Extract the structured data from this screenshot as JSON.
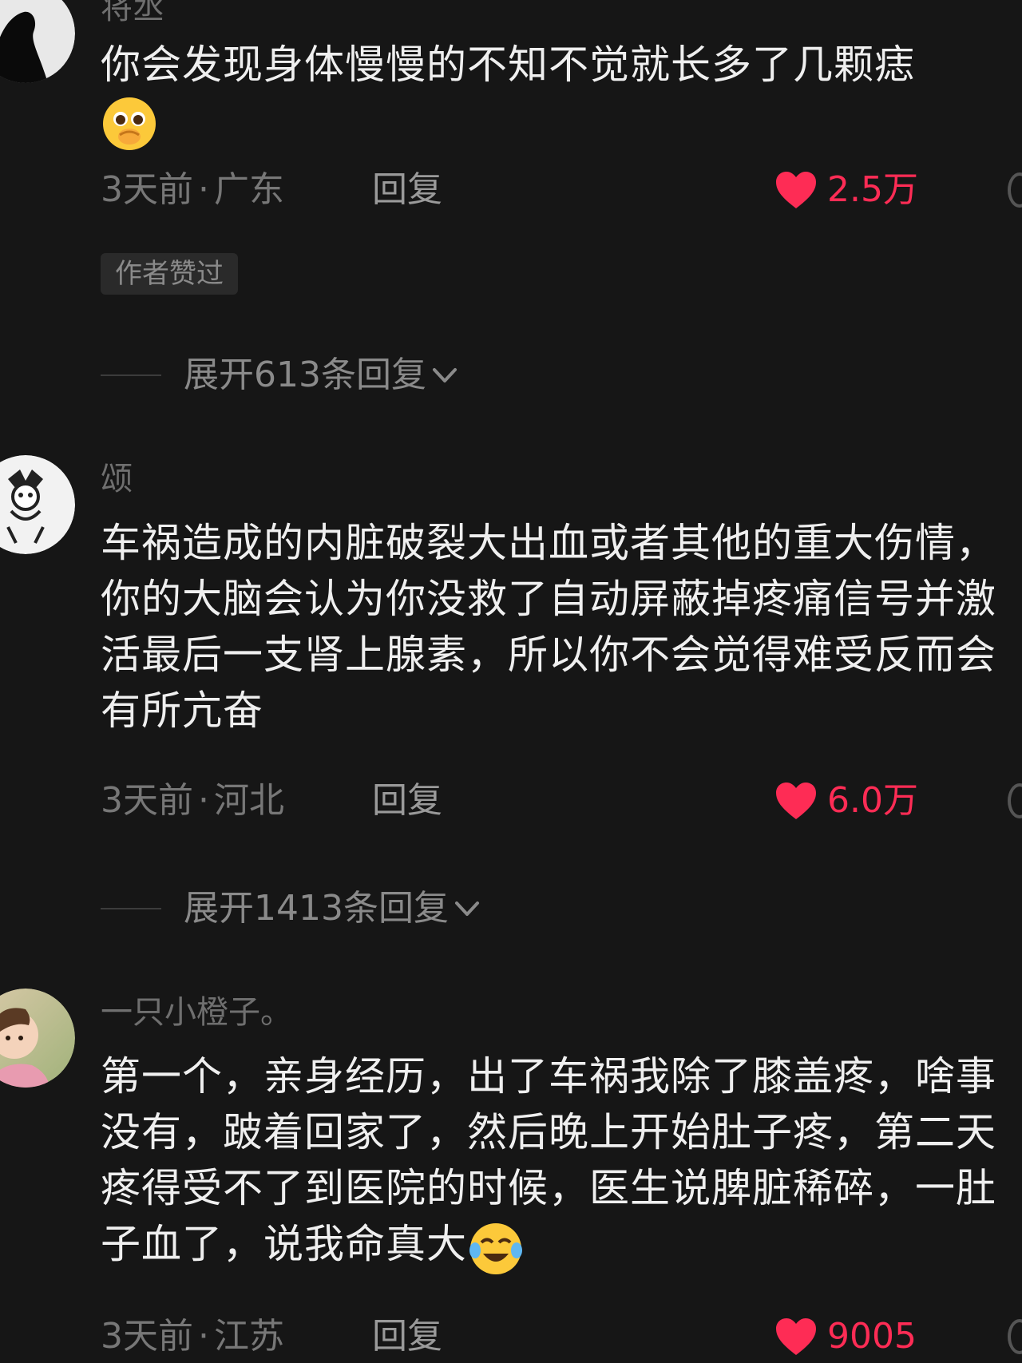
{
  "comments": [
    {
      "username": "将丞",
      "text": "你会发现身体慢慢的不知不觉就长多了几颗痣",
      "time": "3天前",
      "location": "广东",
      "reply_label": "回复",
      "likes": "2.5万",
      "badge": "作者赞过",
      "expand_label": "展开613条回复"
    },
    {
      "username": "颂",
      "text": "车祸造成的内脏破裂大出血或者其他的重大伤情，你的大脑会认为你没救了自动屏蔽掉疼痛信号并激活最后一支肾上腺素，所以你不会觉得难受反而会有所亢奋",
      "time": "3天前",
      "location": "河北",
      "reply_label": "回复",
      "likes": "6.0万",
      "expand_label": "展开1413条回复"
    },
    {
      "username": "一只小橙子。",
      "text": "第一个，亲身经历，出了车祸我除了膝盖疼，啥事没有，跛着回家了，然后晚上开始肚子疼，第二天疼得受不了到医院的时候，医生说脾脏稀碎，一肚子血了，说我命真大",
      "time": "3天前",
      "location": "江苏",
      "reply_label": "回复",
      "likes": "9005"
    }
  ],
  "icons": {
    "like": "heart-icon",
    "expand": "chevron-down-icon",
    "emoji_1": "pleading-face-emoji",
    "emoji_3": "crying-laughing-face-emoji"
  },
  "colors": {
    "background": "#161616",
    "like_accent": "#fe2c55",
    "meta_text": "#777777"
  }
}
